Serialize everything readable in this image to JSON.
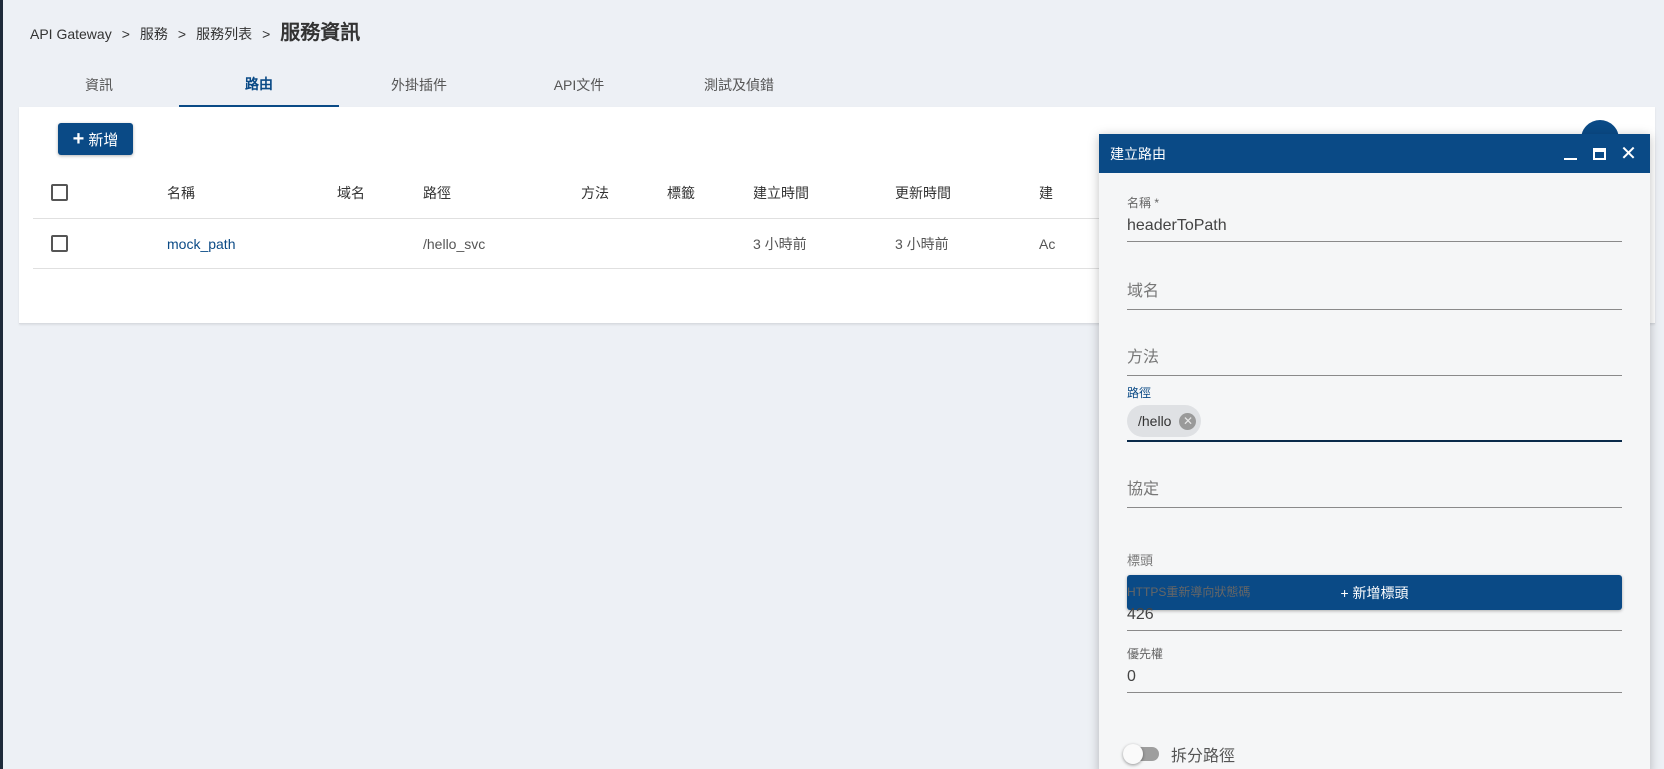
{
  "breadcrumb": {
    "items": [
      "API Gateway",
      "服務",
      "服務列表"
    ],
    "separator": ">",
    "current": "服務資訊"
  },
  "tabs": [
    {
      "label": "資訊",
      "active": false
    },
    {
      "label": "路由",
      "active": true
    },
    {
      "label": "外掛插件",
      "active": false
    },
    {
      "label": "API文件",
      "active": false
    },
    {
      "label": "測試及偵錯",
      "active": false
    }
  ],
  "toolbar": {
    "add_label": "新增",
    "add_icon": "plus-icon"
  },
  "table": {
    "headers": [
      "名稱",
      "域名",
      "路徑",
      "方法",
      "標籤",
      "建立時間",
      "更新時間",
      "建"
    ],
    "rows": [
      {
        "name": "mock_path",
        "domain": "",
        "path": "/hello_svc",
        "method": "",
        "tags": "",
        "created": "3 小時前",
        "updated": "3 小時前",
        "extra": "Ac"
      }
    ]
  },
  "dialog": {
    "title": "建立路由",
    "name_label": "名稱 *",
    "name_value": "headerToPath",
    "domain_placeholder": "域名",
    "method_placeholder": "方法",
    "path_label": "路徑",
    "path_chips": [
      "/hello"
    ],
    "protocol_placeholder": "協定",
    "headers_label": "標頭",
    "add_header_label": "+ 新增標頭",
    "https_label": "HTTPS重新導向狀態碼",
    "https_value": "426",
    "priority_label": "優先權",
    "priority_value": "0",
    "split_path_label": "拆分路徑",
    "split_path_on": false
  },
  "colors": {
    "primary": "#0a4a86",
    "background": "#edf0f5"
  }
}
